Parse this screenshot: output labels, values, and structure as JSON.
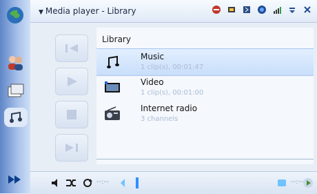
{
  "header": {
    "title": "Media player - Library"
  },
  "library": {
    "title": "Library",
    "items": [
      {
        "label": "Music",
        "sub": "1 clip(s), 00:01:47",
        "icon": "music-note-icon"
      },
      {
        "label": "Video",
        "sub": "1 clip(s), 00:01:00",
        "icon": "video-icon"
      },
      {
        "label": "Internet radio",
        "sub": "3 channels",
        "icon": "radio-icon"
      }
    ]
  },
  "bottom": {
    "time_left": "--:--",
    "time_right": "--:--"
  },
  "colors": {
    "accent": "#2f6fd6",
    "panel": "#f5f8fc",
    "side": "#5f86c7"
  }
}
